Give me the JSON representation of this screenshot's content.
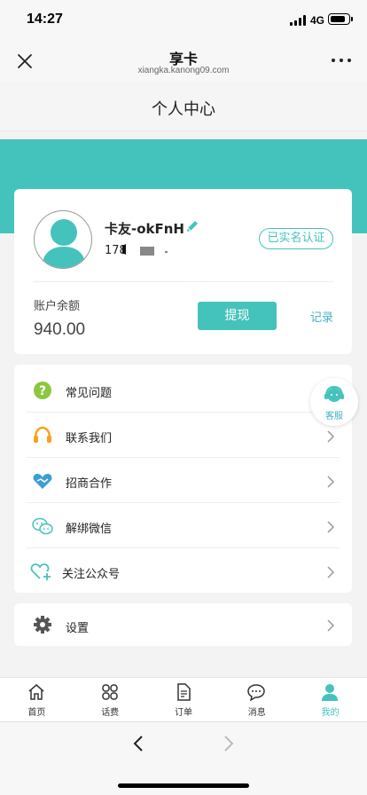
{
  "status_bar": {
    "time": "14:27",
    "network": "4G"
  },
  "nav": {
    "title": "享卡",
    "url": "xiangka.kanong09.com",
    "close_icon": "close-icon",
    "more_icon": "more-icon"
  },
  "page": {
    "title": "个人中心"
  },
  "profile": {
    "username": "卡友-okFnH",
    "phone_prefix": "178",
    "verified_label": "已实名认证",
    "balance_label": "账户余额",
    "balance_value": "940.00",
    "withdraw_label": "提现",
    "records_label": "记录"
  },
  "menu": {
    "items": [
      {
        "label": "常见问题",
        "icon": "question-icon"
      },
      {
        "label": "联系我们",
        "icon": "headset-icon"
      },
      {
        "label": "招商合作",
        "icon": "handshake-heart-icon"
      },
      {
        "label": "解绑微信",
        "icon": "wechat-icon"
      },
      {
        "label": "关注公众号",
        "icon": "heart-plus-icon"
      }
    ],
    "settings_label": "设置"
  },
  "customer_service": {
    "label": "客服"
  },
  "tabs": [
    {
      "label": "首页",
      "icon": "home-icon",
      "active": false
    },
    {
      "label": "话费",
      "icon": "grid-icon",
      "active": false
    },
    {
      "label": "订单",
      "icon": "document-icon",
      "active": false
    },
    {
      "label": "消息",
      "icon": "chat-icon",
      "active": false
    },
    {
      "label": "我的",
      "icon": "user-icon",
      "active": true
    }
  ],
  "colors": {
    "accent": "#44c3bc",
    "link": "#44b0c8",
    "question_green": "#8dc63f",
    "headset_orange": "#f7a21b",
    "blue": "#3a9fd5"
  }
}
